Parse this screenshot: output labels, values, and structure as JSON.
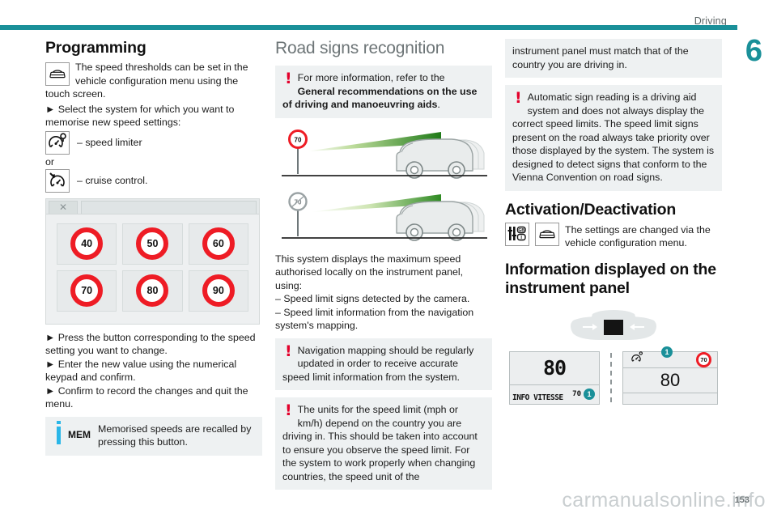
{
  "header": {
    "section_label": "Driving",
    "chapter_number": "6"
  },
  "footer": {
    "watermark": "carmanualsonline.info",
    "page_number": "153"
  },
  "col1": {
    "heading": "Programming",
    "intro": "The speed thresholds can be set in the vehicle configuration menu using the touch screen.",
    "step_select": "►  Select the system for which you want to memorise new speed settings:",
    "option_limiter": "–  speed limiter",
    "or": "or",
    "option_cruise": "–  cruise control.",
    "touchscreen": {
      "close_glyph": "✕",
      "speeds": [
        "40",
        "50",
        "60",
        "70",
        "80",
        "90"
      ]
    },
    "step_press": "►  Press the button corresponding to the speed setting you want to change.",
    "step_enter": "►  Enter the new value using the numerical keypad and confirm.",
    "step_confirm": "►  Confirm to record the changes and quit the menu.",
    "info_box": {
      "mem_label": "MEM",
      "text": "Memorised speeds are recalled by pressing this button."
    }
  },
  "col2": {
    "heading": "Road signs recognition",
    "warning_1": {
      "bang": "!",
      "text_plain_1": "For more information, refer to the ",
      "text_bold": "General recommendations on the use of driving and manoeuvring aids",
      "text_plain_2": "."
    },
    "scene": {
      "sign_top": "70",
      "sign_bottom": "70"
    },
    "body_1": "This system displays the maximum speed authorised locally on the instrument panel, using:",
    "bullet_1": "–  Speed limit signs detected by the camera.",
    "bullet_2": "–  Speed limit information from the navigation system's mapping.",
    "warning_2": {
      "bang": "!",
      "text": "Navigation mapping should be regularly updated in order to receive accurate speed limit information from the system."
    },
    "warning_3": {
      "bang": "!",
      "text": "The units for the speed limit (mph or km/h) depend on the country you are driving in. This should be taken into account to ensure you observe the speed limit. For the system to work properly when changing countries, the speed unit of the"
    }
  },
  "col3": {
    "continuation": "instrument panel must match that of the country you are driving in.",
    "warning_4": {
      "bang": "!",
      "text": "Automatic sign reading is a driving aid system and does not always display the correct speed limits. The speed limit signs present on the road always take priority over those displayed by the system. The system is designed to detect signs that conform to the Vienna Convention on road signs."
    },
    "heading_activation": "Activation/Deactivation",
    "activation_text": "The settings are changed via the vehicle configuration menu.",
    "heading_info": "Information displayed on the instrument panel",
    "panel_left": {
      "main_value": "80",
      "sub_value": "70",
      "label": "INFO VITESSE",
      "callout": "1"
    },
    "panel_right": {
      "sign_value": "70",
      "main_value": "80",
      "callout": "1"
    }
  },
  "colors": {
    "accent_teal": "#1a9099",
    "warning_red": "#e3002b",
    "sign_red": "#ee1c25",
    "info_blue": "#29b6e8",
    "box_grey": "#eef1f2"
  }
}
